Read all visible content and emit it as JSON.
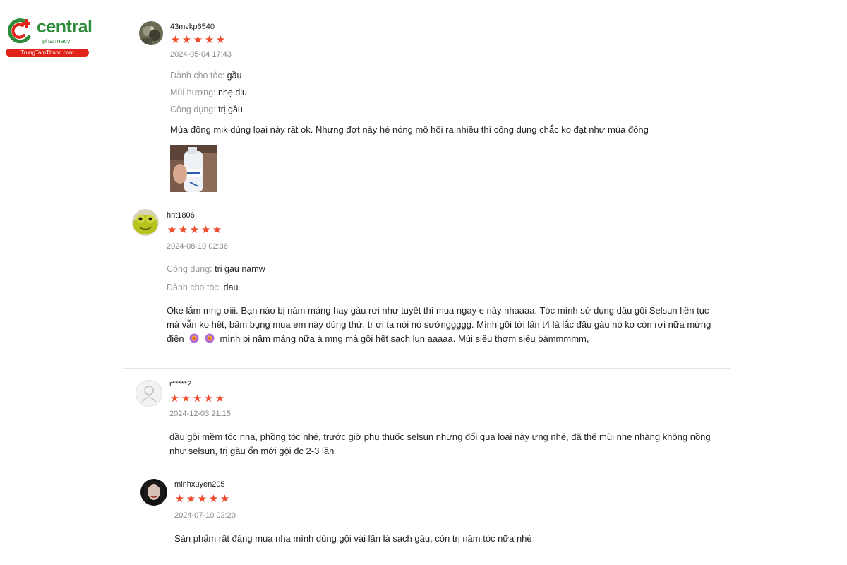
{
  "logo": {
    "brand": "central",
    "sub": "pharmacy",
    "site": "TrungTamThuoc.com"
  },
  "colors": {
    "star": "#ee4d2d",
    "brand_green": "#2e8b3a",
    "brand_red": "#e2231a"
  },
  "reviews": [
    {
      "username": "43mvkp6540",
      "stars": [
        "★",
        "★",
        "★",
        "★",
        "★"
      ],
      "date": "2024-05-04 17:43",
      "attributes": [
        {
          "label": "Dành cho tóc:",
          "value": "gầu"
        },
        {
          "label": "Mùi hương:",
          "value": "nhẹ dịu"
        },
        {
          "label": "Công dụng:",
          "value": "trị gầu"
        }
      ],
      "comment": "Mùa đông mik dùng loại này rất ok. Nhưng đợt này hè nóng mồ hôi ra nhiều thì công dụng chắc ko đạt như mùa đông",
      "has_photo": true
    },
    {
      "username": "hnt1806",
      "stars": [
        "★",
        "★",
        "★",
        "★",
        "★"
      ],
      "date": "2024-08-19 02:36",
      "attributes": [
        {
          "label": "Công dụng:",
          "value": "trị gau namw"
        },
        {
          "label": "Dành cho tóc:",
          "value": "dau"
        }
      ],
      "comment_lines": [
        "Oke lắm mng ơiii. Bạn nào bị nấm mảng hay gàu rơi như tuyết thì mua ngay e này nhaaaa. Tóc mình sử dụng dầu gội Selsun liên tục",
        "mà vẫn ko hết, bấm bụng mua em này dùng thử, tr ơi ta nói nó sướnggggg. Mình gội tới lần t4 là lắc đầu gàu nó ko còn rơi nữa mừng",
        "điên",
        "mình bị nấm mảng nữa á mng mà gội hết sạch lun aaaaa. Mùi siêu thơm siêu bámmmmm,"
      ]
    },
    {
      "username": "r*****2",
      "stars": [
        "★",
        "★",
        "★",
        "★",
        "★"
      ],
      "date": "2024-12-03 21:15",
      "comment_lines": [
        "dầu gội mềm tóc nha, phồng tóc nhé, trước giờ phụ thuốc selsun nhưng đổi qua loại này ưng nhé, đã thế mùi nhẹ nhàng không nồng",
        "như selsun, trị gàu ổn mới gội đc 2-3 lần"
      ]
    },
    {
      "username": "minhxuyen205",
      "stars": [
        "★",
        "★",
        "★",
        "★",
        "★"
      ],
      "date": "2024-07-10 02:20",
      "comment": "Sản phẩm rất đáng mua nha mình dùng gội vài lần là sạch gàu, còn trị nấm tóc nữa nhé"
    }
  ]
}
